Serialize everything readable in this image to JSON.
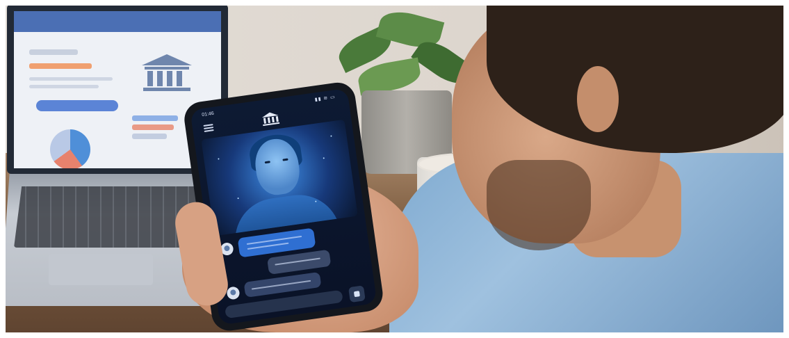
{
  "phone": {
    "status_time": "01:46",
    "status_icons": "▮▮ ≋ ▭"
  },
  "icons": {
    "menu": "hamburger-menu-icon",
    "bank": "bank-building-icon",
    "user": "user-avatar-icon",
    "send": "send-icon"
  },
  "colors": {
    "phone_bg": "#0a1227",
    "accent": "#3f8ee6",
    "user_bubble": "#2f6fd2",
    "bot_bubble": "#3b4a6a",
    "shirt": "#8fb6da"
  }
}
